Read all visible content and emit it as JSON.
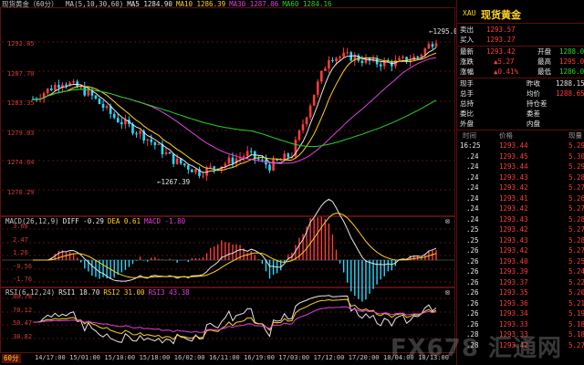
{
  "chart": {
    "title": "现货黄金（60分）",
    "ma_labels": [
      {
        "text": "MA(5,10,30,60)",
        "color": "#c8c8c8"
      },
      {
        "text": "MA5 1284.90",
        "color": "#e6e6e6"
      },
      {
        "text": "MA10 1286.39",
        "color": "#ffd21e"
      },
      {
        "text": "MA30 1287.06",
        "color": "#e040e0"
      },
      {
        "text": "MA60 1284.16",
        "color": "#28d228"
      }
    ],
    "price_ticks": [
      "1292.85",
      "1287.70",
      "1283.35",
      "1279.03",
      "1274.64",
      "1270.29"
    ],
    "high_label": "1295.02",
    "low_label": "1267.39",
    "macd_labels": [
      {
        "text": "MACD(26,12,9)",
        "color": "#c8c8c8"
      },
      {
        "text": "DIFF -0.29",
        "color": "#e6e6e6"
      },
      {
        "text": "DEA 0.61",
        "color": "#ffd21e"
      },
      {
        "text": "MACD -1.80",
        "color": "#e040e0"
      }
    ],
    "macd_ticks": [
      "3.68",
      "2.47",
      "1.26",
      "-0.56",
      "-1.76"
    ],
    "rsi_labels": [
      {
        "text": "RSI(6,12,24)",
        "color": "#c8c8c8"
      },
      {
        "text": "RSI1 18.70",
        "color": "#e6e6e6"
      },
      {
        "text": "RSI2 31.00",
        "color": "#ffd21e"
      },
      {
        "text": "RSI3 43.38",
        "color": "#e040e0"
      }
    ],
    "rsi_ticks": [
      "80.78",
      "70.12",
      "50.47",
      "30.82"
    ],
    "period_label": "60分",
    "time_ticks": [
      "14/17:00",
      "15/01:00",
      "15/10:00",
      "15/18:00",
      "16/02:00",
      "16/11:00",
      "16/19:00",
      "17/03:00",
      "17/12:00",
      "17/20:00",
      "18/04:00",
      "18/13:00"
    ],
    "colors": {
      "up": "#ff3b3b",
      "down": "#28d8ff",
      "ma5": "#e6e6e6",
      "ma10": "#ffd21e",
      "ma30": "#e040e0",
      "ma60": "#28d228",
      "grid": "#5a1010"
    }
  },
  "quote": {
    "code": "XAU",
    "name": "现货黄金",
    "ask_label": "卖出",
    "ask": "1293.57",
    "bid_label": "买入",
    "bid": "1293.27",
    "last_label": "最新",
    "last": "1293.42",
    "open_label": "开盘",
    "open": "1288.00",
    "change_label": "涨跌",
    "change": "▲5.27",
    "high_label": "最高",
    "high": "1295.02",
    "pct_label": "涨幅",
    "pct": "▲0.41%",
    "low_label": "最低",
    "low": "1286.00",
    "vol_label": "现手",
    "vol_extra": "昨收",
    "prev_close": "1288.15",
    "total_label": "总手",
    "avg_label": "均价",
    "avg": "1288.65",
    "hold_label": "总持",
    "hold_extra": "持仓差",
    "ratio_label": "委比",
    "ratio_extra": "委差",
    "outer_label": "外盘",
    "inner_label": "内盘",
    "col_time": "时间",
    "col_price": "价格",
    "col_vol": "现量",
    "ticks": [
      {
        "t": "16:25",
        "p": "1293.44",
        "v": "5.29"
      },
      {
        "t": ".24",
        "p": "1293.45",
        "v": "5.30"
      },
      {
        "t": ".24",
        "p": "1293.44",
        "v": "5.29"
      },
      {
        "t": ".24",
        "p": "1293.43",
        "v": "5.28"
      },
      {
        "t": ".24",
        "p": "1293.42",
        "v": "5.27"
      },
      {
        "t": ".24",
        "p": "1293.41",
        "v": "5.26"
      },
      {
        "t": ".24",
        "p": "1293.42",
        "v": "5.27"
      },
      {
        "t": ".24",
        "p": "1293.43",
        "v": "5.28"
      },
      {
        "t": ".25",
        "p": "1293.42",
        "v": "5.27"
      },
      {
        "t": ".25",
        "p": "1293.43",
        "v": "5.28"
      },
      {
        "t": ".26",
        "p": "1293.42",
        "v": "5.27"
      },
      {
        "t": ".26",
        "p": "1293.40",
        "v": "5.25"
      },
      {
        "t": ".26",
        "p": "1293.39",
        "v": "5.24"
      },
      {
        "t": ".26",
        "p": "1293.37",
        "v": "5.22"
      },
      {
        "t": ".26",
        "p": "1293.35",
        "v": "5.20"
      },
      {
        "t": ".26",
        "p": "1293.36",
        "v": "5.21"
      },
      {
        "t": ".26",
        "p": "1293.34",
        "v": "5.19"
      },
      {
        "t": ".26",
        "p": "1293.33",
        "v": "5.18"
      },
      {
        "t": ".28",
        "p": "1293.33",
        "v": "5.18"
      },
      {
        "t": ".28",
        "p": "1293.42",
        "v": "5.27"
      }
    ],
    "watermark": "FX678 汇通网"
  }
}
